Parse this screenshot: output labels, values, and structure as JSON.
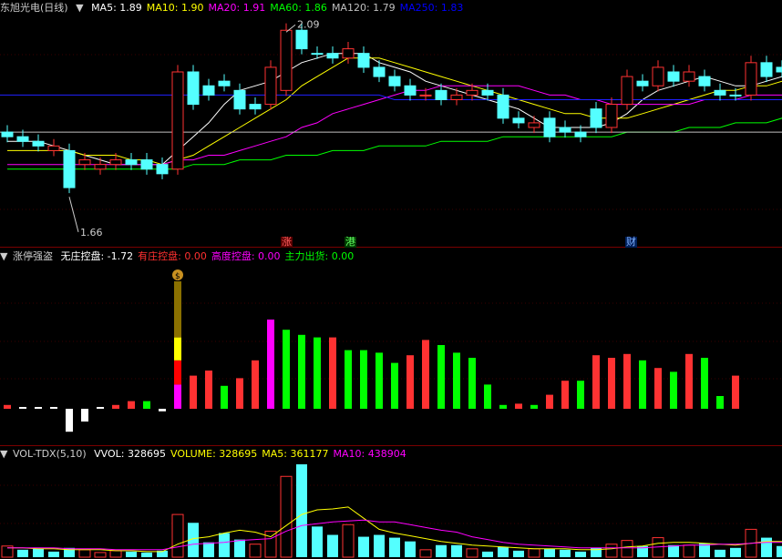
{
  "main": {
    "title": "东旭光电(日线)",
    "indicators": [
      {
        "label": "MA5: 1.89",
        "color": "#ffffff"
      },
      {
        "label": "MA10: 1.90",
        "color": "#ffff00"
      },
      {
        "label": "MA20: 1.91",
        "color": "#ff00ff"
      },
      {
        "label": "MA60: 1.86",
        "color": "#00ff00"
      },
      {
        "label": "MA120: 1.79",
        "color": "#c0c0c0"
      },
      {
        "label": "MA250: 1.83",
        "color": "#0000ff"
      }
    ],
    "high_label": "2.09",
    "low_label": "1.66",
    "tags": {
      "zhang": "涨",
      "gang": "港",
      "cai": "财"
    }
  },
  "indicator_panel": {
    "title": "涨停强盗",
    "items": [
      {
        "label": "无庄控盘: -1.72",
        "color": "#ffffff"
      },
      {
        "label": "有庄控盘: 0.00",
        "color": "#ff3030"
      },
      {
        "label": "高度控盘: 0.00",
        "color": "#ff00ff"
      },
      {
        "label": "主力出货: 0.00",
        "color": "#00ff00"
      }
    ],
    "bag_icon_text": "$"
  },
  "volume_panel": {
    "title": "VOL-TDX(5,10)",
    "items": [
      {
        "label": "VVOL: 328695",
        "color": "#ffffff"
      },
      {
        "label": "VOLUME: 328695",
        "color": "#ffff00"
      },
      {
        "label": "MA5: 361177",
        "color": "#ffff00"
      },
      {
        "label": "MA10: 438904",
        "color": "#ff00ff"
      }
    ]
  },
  "colors": {
    "up": "#ff3232",
    "down": "#54ffff",
    "grid": "#7a0000"
  },
  "chart_data": {
    "type": "candlestick",
    "candles": [
      [
        2,
        1.87,
        1.86
      ],
      [
        0,
        1.86,
        1.85
      ],
      [
        0,
        1.85,
        1.84
      ],
      [
        1,
        1.84,
        1.83
      ],
      [
        0,
        1.83,
        1.75
      ],
      [
        1,
        1.8,
        1.81
      ],
      [
        1,
        1.79,
        1.8
      ],
      [
        1,
        1.8,
        1.81
      ],
      [
        0,
        1.81,
        1.8
      ],
      [
        0,
        1.81,
        1.79
      ],
      [
        0,
        1.8,
        1.78
      ],
      [
        1,
        1.79,
        2.0
      ],
      [
        0,
        2.0,
        1.93
      ],
      [
        0,
        1.97,
        1.95
      ],
      [
        0,
        1.98,
        1.97
      ],
      [
        0,
        1.96,
        1.92
      ],
      [
        0,
        1.93,
        1.92
      ],
      [
        1,
        1.93,
        2.01
      ],
      [
        1,
        1.96,
        2.09
      ],
      [
        0,
        2.09,
        2.05
      ],
      [
        0,
        2.04,
        2.04
      ],
      [
        0,
        2.04,
        2.03
      ],
      [
        1,
        2.03,
        2.05
      ],
      [
        0,
        2.04,
        2.01
      ],
      [
        0,
        2.01,
        1.99
      ],
      [
        0,
        1.99,
        1.97
      ],
      [
        0,
        1.97,
        1.95
      ],
      [
        1,
        1.95,
        1.95
      ],
      [
        0,
        1.96,
        1.94
      ],
      [
        1,
        1.94,
        1.95
      ],
      [
        1,
        1.95,
        1.96
      ],
      [
        0,
        1.96,
        1.95
      ],
      [
        0,
        1.95,
        1.9
      ],
      [
        0,
        1.9,
        1.89
      ],
      [
        1,
        1.88,
        1.89
      ],
      [
        0,
        1.9,
        1.86
      ],
      [
        0,
        1.88,
        1.87
      ],
      [
        0,
        1.87,
        1.86
      ],
      [
        0,
        1.92,
        1.88
      ],
      [
        1,
        1.88,
        1.93
      ],
      [
        1,
        1.93,
        1.99
      ],
      [
        0,
        1.98,
        1.97
      ],
      [
        1,
        1.97,
        2.01
      ],
      [
        0,
        2.0,
        1.98
      ],
      [
        1,
        1.98,
        2.0
      ],
      [
        0,
        1.99,
        1.97
      ],
      [
        0,
        1.96,
        1.95
      ],
      [
        0,
        1.95,
        1.95
      ],
      [
        1,
        1.95,
        2.02
      ],
      [
        0,
        2.02,
        1.99
      ],
      [
        0,
        2.01,
        2.0
      ],
      [
        1,
        2.01,
        2.02
      ],
      [
        0,
        2.02,
        2.01
      ]
    ],
    "ma": {
      "ma5": [
        1.85,
        1.85,
        1.85,
        1.84,
        1.83,
        1.82,
        1.81,
        1.8,
        1.8,
        1.8,
        1.8,
        1.83,
        1.86,
        1.89,
        1.93,
        1.96,
        1.97,
        1.98,
        2.0,
        2.02,
        2.03,
        2.04,
        2.04,
        2.04,
        2.02,
        2.01,
        2.0,
        1.98,
        1.97,
        1.96,
        1.95,
        1.94,
        1.93,
        1.92,
        1.9,
        1.88,
        1.88,
        1.88,
        1.88,
        1.89,
        1.91,
        1.94,
        1.96,
        1.97,
        1.98,
        1.99,
        1.98,
        1.97,
        1.97,
        1.98,
        1.99,
        2.0,
        2.0
      ],
      "ma10": [
        1.83,
        1.83,
        1.83,
        1.83,
        1.83,
        1.82,
        1.82,
        1.82,
        1.81,
        1.81,
        1.8,
        1.81,
        1.82,
        1.84,
        1.86,
        1.88,
        1.9,
        1.92,
        1.94,
        1.97,
        1.99,
        2.01,
        2.03,
        2.03,
        2.03,
        2.02,
        2.01,
        2.0,
        1.99,
        1.98,
        1.97,
        1.96,
        1.95,
        1.94,
        1.93,
        1.92,
        1.91,
        1.91,
        1.9,
        1.9,
        1.9,
        1.91,
        1.92,
        1.93,
        1.94,
        1.95,
        1.96,
        1.96,
        1.97,
        1.97,
        1.98,
        1.98,
        1.99
      ],
      "ma20": [
        1.8,
        1.8,
        1.8,
        1.8,
        1.8,
        1.8,
        1.8,
        1.8,
        1.8,
        1.8,
        1.8,
        1.81,
        1.81,
        1.82,
        1.82,
        1.83,
        1.84,
        1.85,
        1.86,
        1.88,
        1.89,
        1.91,
        1.92,
        1.93,
        1.94,
        1.95,
        1.96,
        1.96,
        1.97,
        1.97,
        1.97,
        1.97,
        1.97,
        1.97,
        1.96,
        1.95,
        1.95,
        1.94,
        1.94,
        1.93,
        1.93,
        1.93,
        1.93,
        1.93,
        1.93,
        1.94,
        1.94,
        1.94,
        1.95,
        1.95,
        1.95,
        1.96,
        1.96
      ],
      "ma60": [
        1.79,
        1.79,
        1.79,
        1.79,
        1.79,
        1.79,
        1.79,
        1.79,
        1.79,
        1.79,
        1.79,
        1.79,
        1.8,
        1.8,
        1.8,
        1.81,
        1.81,
        1.81,
        1.82,
        1.82,
        1.82,
        1.83,
        1.83,
        1.83,
        1.84,
        1.84,
        1.84,
        1.84,
        1.85,
        1.85,
        1.85,
        1.85,
        1.86,
        1.86,
        1.86,
        1.86,
        1.86,
        1.86,
        1.86,
        1.86,
        1.87,
        1.87,
        1.87,
        1.87,
        1.88,
        1.88,
        1.88,
        1.89,
        1.89,
        1.89,
        1.9,
        1.9,
        1.9
      ],
      "ma120": [
        1.87,
        1.87,
        1.87,
        1.87,
        1.87,
        1.87,
        1.87,
        1.87,
        1.87,
        1.87,
        1.87,
        1.87,
        1.87,
        1.87,
        1.87,
        1.87,
        1.87,
        1.87,
        1.87,
        1.87,
        1.87,
        1.87,
        1.87,
        1.87,
        1.87,
        1.87,
        1.87,
        1.87,
        1.87,
        1.87,
        1.87,
        1.87,
        1.87,
        1.87,
        1.87,
        1.87,
        1.87,
        1.87,
        1.87,
        1.87,
        1.87,
        1.87,
        1.87,
        1.87,
        1.87,
        1.87,
        1.87,
        1.87,
        1.87,
        1.87,
        1.87,
        1.87,
        1.87
      ],
      "ma250": [
        1.95,
        1.95,
        1.95,
        1.95,
        1.95,
        1.95,
        1.95,
        1.95,
        1.95,
        1.95,
        1.95,
        1.95,
        1.95,
        1.95,
        1.95,
        1.95,
        1.95,
        1.95,
        1.95,
        1.95,
        1.95,
        1.95,
        1.95,
        1.95,
        1.95,
        1.94,
        1.94,
        1.94,
        1.94,
        1.94,
        1.94,
        1.94,
        1.94,
        1.94,
        1.94,
        1.94,
        1.94,
        1.94,
        1.94,
        1.94,
        1.94,
        1.94,
        1.94,
        1.94,
        1.94,
        1.94,
        1.94,
        1.94,
        1.94,
        1.94,
        1.94,
        1.94,
        1.94
      ]
    },
    "indicator_bars": [
      [
        1,
        0.03
      ],
      [
        2,
        0.01
      ],
      [
        2,
        0.01
      ],
      [
        2,
        0.01
      ],
      [
        3,
        -0.18
      ],
      [
        3,
        -0.1
      ],
      [
        2,
        0.01
      ],
      [
        1,
        0.03
      ],
      [
        1,
        0.06
      ],
      [
        4,
        0.06
      ],
      [
        2,
        -0.02
      ],
      [
        9,
        1.0
      ],
      [
        1,
        0.26
      ],
      [
        1,
        0.3
      ],
      [
        4,
        0.18
      ],
      [
        1,
        0.24
      ],
      [
        1,
        0.38
      ],
      [
        5,
        0.7
      ],
      [
        4,
        0.62
      ],
      [
        4,
        0.58
      ],
      [
        4,
        0.56
      ],
      [
        1,
        0.56
      ],
      [
        4,
        0.46
      ],
      [
        4,
        0.46
      ],
      [
        4,
        0.44
      ],
      [
        4,
        0.36
      ],
      [
        1,
        0.42
      ],
      [
        1,
        0.54
      ],
      [
        4,
        0.5
      ],
      [
        4,
        0.44
      ],
      [
        4,
        0.4
      ],
      [
        4,
        0.19
      ],
      [
        4,
        0.03
      ],
      [
        1,
        0.04
      ],
      [
        4,
        0.03
      ],
      [
        1,
        0.11
      ],
      [
        1,
        0.22
      ],
      [
        4,
        0.22
      ],
      [
        1,
        0.42
      ],
      [
        1,
        0.4
      ],
      [
        1,
        0.43
      ],
      [
        4,
        0.38
      ],
      [
        1,
        0.32
      ],
      [
        4,
        0.29
      ],
      [
        1,
        0.43
      ],
      [
        4,
        0.4
      ],
      [
        4,
        0.1
      ],
      [
        1,
        0.26
      ]
    ],
    "volume": [
      [
        1,
        0.12
      ],
      [
        0,
        0.08
      ],
      [
        0,
        0.09
      ],
      [
        0,
        0.06
      ],
      [
        0,
        0.1
      ],
      [
        1,
        0.08
      ],
      [
        1,
        0.05
      ],
      [
        1,
        0.07
      ],
      [
        0,
        0.06
      ],
      [
        0,
        0.05
      ],
      [
        0,
        0.07
      ],
      [
        1,
        0.46
      ],
      [
        0,
        0.37
      ],
      [
        0,
        0.16
      ],
      [
        0,
        0.26
      ],
      [
        0,
        0.19
      ],
      [
        1,
        0.14
      ],
      [
        1,
        0.28
      ],
      [
        1,
        0.87
      ],
      [
        0,
        1.0
      ],
      [
        0,
        0.33
      ],
      [
        0,
        0.24
      ],
      [
        1,
        0.35
      ],
      [
        0,
        0.22
      ],
      [
        0,
        0.24
      ],
      [
        0,
        0.21
      ],
      [
        0,
        0.17
      ],
      [
        1,
        0.08
      ],
      [
        0,
        0.13
      ],
      [
        0,
        0.13
      ],
      [
        1,
        0.09
      ],
      [
        0,
        0.06
      ],
      [
        0,
        0.11
      ],
      [
        0,
        0.07
      ],
      [
        1,
        0.09
      ],
      [
        0,
        0.09
      ],
      [
        0,
        0.08
      ],
      [
        0,
        0.06
      ],
      [
        0,
        0.1
      ],
      [
        1,
        0.14
      ],
      [
        1,
        0.18
      ],
      [
        0,
        0.12
      ],
      [
        1,
        0.21
      ],
      [
        0,
        0.13
      ],
      [
        1,
        0.13
      ],
      [
        0,
        0.15
      ],
      [
        0,
        0.08
      ],
      [
        0,
        0.1
      ],
      [
        1,
        0.3
      ],
      [
        0,
        0.21
      ],
      [
        0,
        0.12
      ],
      [
        1,
        0.15
      ],
      [
        0,
        0.08
      ]
    ],
    "vol_ma5": [
      0.1,
      0.1,
      0.09,
      0.09,
      0.08,
      0.08,
      0.08,
      0.07,
      0.07,
      0.06,
      0.06,
      0.14,
      0.2,
      0.22,
      0.26,
      0.29,
      0.27,
      0.22,
      0.34,
      0.46,
      0.51,
      0.52,
      0.54,
      0.42,
      0.3,
      0.26,
      0.23,
      0.2,
      0.17,
      0.15,
      0.13,
      0.12,
      0.11,
      0.1,
      0.09,
      0.09,
      0.09,
      0.08,
      0.08,
      0.09,
      0.11,
      0.12,
      0.15,
      0.16,
      0.16,
      0.15,
      0.14,
      0.13,
      0.15,
      0.17,
      0.17,
      0.17,
      0.18
    ],
    "vol_ma10": [
      0.1,
      0.1,
      0.1,
      0.1,
      0.09,
      0.09,
      0.09,
      0.08,
      0.08,
      0.08,
      0.08,
      0.11,
      0.14,
      0.15,
      0.16,
      0.18,
      0.19,
      0.2,
      0.28,
      0.34,
      0.36,
      0.38,
      0.39,
      0.4,
      0.38,
      0.38,
      0.35,
      0.32,
      0.29,
      0.27,
      0.22,
      0.19,
      0.16,
      0.14,
      0.13,
      0.12,
      0.11,
      0.1,
      0.1,
      0.1,
      0.1,
      0.1,
      0.11,
      0.12,
      0.13,
      0.13,
      0.14,
      0.14,
      0.15,
      0.16,
      0.16,
      0.16,
      0.17
    ]
  }
}
